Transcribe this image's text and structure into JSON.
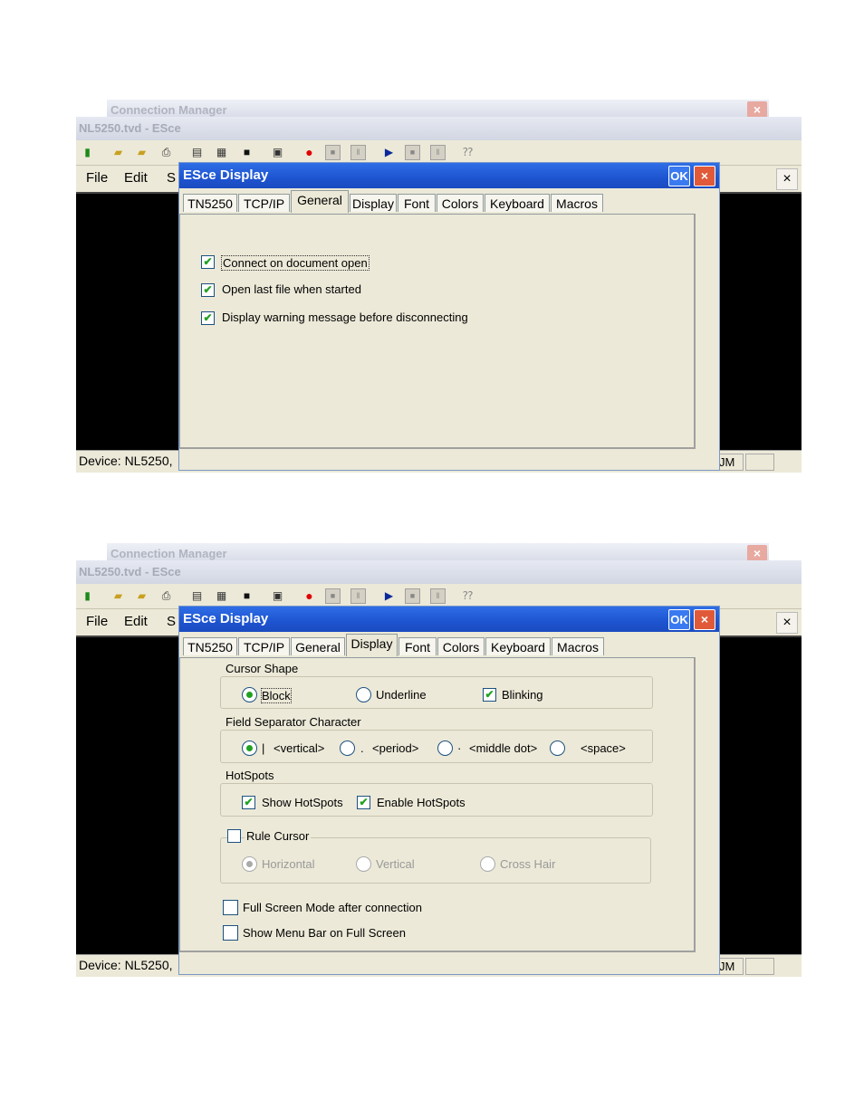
{
  "window": {
    "connection_manager_title": "Connection Manager",
    "app_title": "NL5250.tvd - ESce",
    "close_glyph": "×"
  },
  "menu": {
    "file": "File",
    "edit": "Edit",
    "partial": "S"
  },
  "status": {
    "device": "Device: NL5250,",
    "um": "JM"
  },
  "dialog": {
    "title": "ESce Display",
    "ok_label": "OK",
    "close_glyph": "×",
    "tabs": [
      "TN5250",
      "TCP/IP",
      "General",
      "Display",
      "Font",
      "Colors",
      "Keyboard",
      "Macros"
    ]
  },
  "general": {
    "active_tab": "General",
    "options": [
      {
        "label": "Connect on document open",
        "checked": true
      },
      {
        "label": "Open last file when started",
        "checked": true
      },
      {
        "label": "Display warning message before disconnecting",
        "checked": true
      }
    ]
  },
  "display": {
    "active_tab": "Display",
    "cursor_shape": {
      "title": "Cursor Shape",
      "block": "Block",
      "underline": "Underline",
      "blinking": "Blinking",
      "selected": "Block",
      "blinking_checked": true
    },
    "field_separator": {
      "title": "Field Separator Character",
      "options": [
        {
          "symbol": "|",
          "label": "<vertical>",
          "selected": true
        },
        {
          "symbol": ".",
          "label": "<period>",
          "selected": false
        },
        {
          "symbol": "·",
          "label": "<middle dot>",
          "selected": false
        },
        {
          "symbol": "",
          "label": "<space>",
          "selected": false
        }
      ]
    },
    "hotspots": {
      "title": "HotSpots",
      "show": "Show HotSpots",
      "enable": "Enable HotSpots",
      "show_checked": true,
      "enable_checked": true
    },
    "rule_cursor": {
      "title": "Rule Cursor",
      "checked": false,
      "horizontal": "Horizontal",
      "vertical": "Vertical",
      "cross_hair": "Cross Hair",
      "selected": "Horizontal"
    },
    "full_screen": {
      "label": "Full Screen Mode after connection",
      "checked": false
    },
    "menu_bar": {
      "label": "Show Menu Bar on Full Screen",
      "checked": false
    }
  },
  "icons": [
    "connect-icon",
    "open-folder-icon",
    "save-folder-icon",
    "print-icon",
    "copy-icon",
    "paste-icon",
    "monitor-icon",
    "capture-icon",
    "record-icon",
    "stop-icon",
    "pause-icon",
    "play-icon",
    "stop-play-icon",
    "pause-play-icon",
    "help-icon"
  ],
  "colors": {
    "dialog_title_bar": "#1e54d0",
    "check_green": "#21a121",
    "close_red": "#e05a3a",
    "terminal_black": "#000000"
  }
}
